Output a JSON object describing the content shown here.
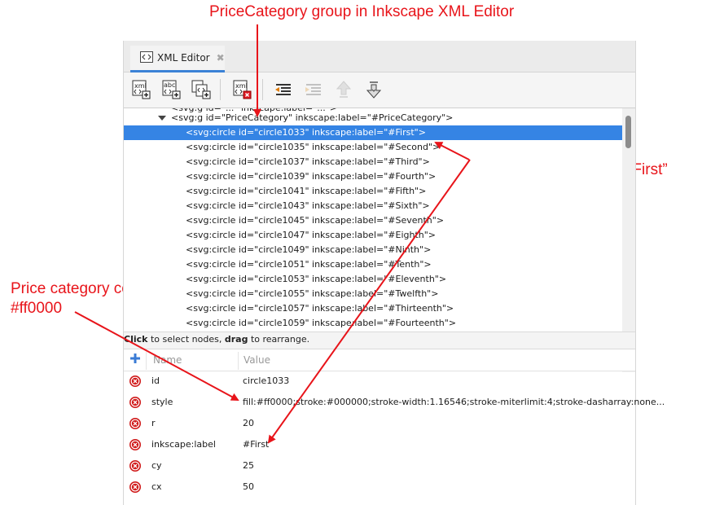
{
  "annotations": {
    "top": "PriceCategory group in Inkscape XML Editor",
    "first": "Price category named “First”",
    "color_line1": "Price category color",
    "color_line2": "#ff0000",
    "color": "#e8141a"
  },
  "tab": {
    "label": "XML Editor",
    "icon": "xml-editor-icon",
    "close_icon": "close-icon"
  },
  "toolbar": {
    "buttons": [
      {
        "name": "new-element-node",
        "label": "xml"
      },
      {
        "name": "new-text-node",
        "label": "abc"
      },
      {
        "name": "duplicate-node",
        "label": ""
      },
      {
        "name": "delete-node",
        "label": "xml"
      },
      {
        "name": "unindent-node",
        "label": ""
      },
      {
        "name": "indent-node",
        "label": ""
      },
      {
        "name": "raise-node",
        "label": ""
      },
      {
        "name": "lower-node",
        "label": ""
      }
    ]
  },
  "tree": {
    "cut_row": "<svg:g id=\"...\" inkscape:label=\"...\">",
    "group": "<svg:g id=\"PriceCategory\" inkscape:label=\"#PriceCategory\">",
    "nodes": [
      "<svg:circle id=\"circle1033\" inkscape:label=\"#First\">",
      "<svg:circle id=\"circle1035\" inkscape:label=\"#Second\">",
      "<svg:circle id=\"circle1037\" inkscape:label=\"#Third\">",
      "<svg:circle id=\"circle1039\" inkscape:label=\"#Fourth\">",
      "<svg:circle id=\"circle1041\" inkscape:label=\"#Fifth\">",
      "<svg:circle id=\"circle1043\" inkscape:label=\"#Sixth\">",
      "<svg:circle id=\"circle1045\" inkscape:label=\"#Seventh\">",
      "<svg:circle id=\"circle1047\" inkscape:label=\"#Eighth\">",
      "<svg:circle id=\"circle1049\" inkscape:label=\"#Ninth\">",
      "<svg:circle id=\"circle1051\" inkscape:label=\"#Tenth\">",
      "<svg:circle id=\"circle1053\" inkscape:label=\"#Eleventh\">",
      "<svg:circle id=\"circle1055\" inkscape:label=\"#Twelfth\">",
      "<svg:circle id=\"circle1057\" inkscape:label=\"#Thirteenth\">",
      "<svg:circle id=\"circle1059\" inkscape:label=\"#Fourteenth\">"
    ],
    "selected_index": 0,
    "selection_color": "#3584e4"
  },
  "hint": {
    "click": "Click",
    "mid": " to select nodes, ",
    "drag": "drag",
    "end": " to rearrange."
  },
  "attributes": {
    "header_name": "Name",
    "header_value": "Value",
    "rows": [
      {
        "name": "id",
        "value": "circle1033"
      },
      {
        "name": "style",
        "value": "fill:#ff0000;stroke:#000000;stroke-width:1.16546;stroke-miterlimit:4;stroke-dasharray:none..."
      },
      {
        "name": "r",
        "value": "20"
      },
      {
        "name": "inkscape:label",
        "value": "#First"
      },
      {
        "name": "cy",
        "value": "25"
      },
      {
        "name": "cx",
        "value": "50"
      }
    ]
  }
}
